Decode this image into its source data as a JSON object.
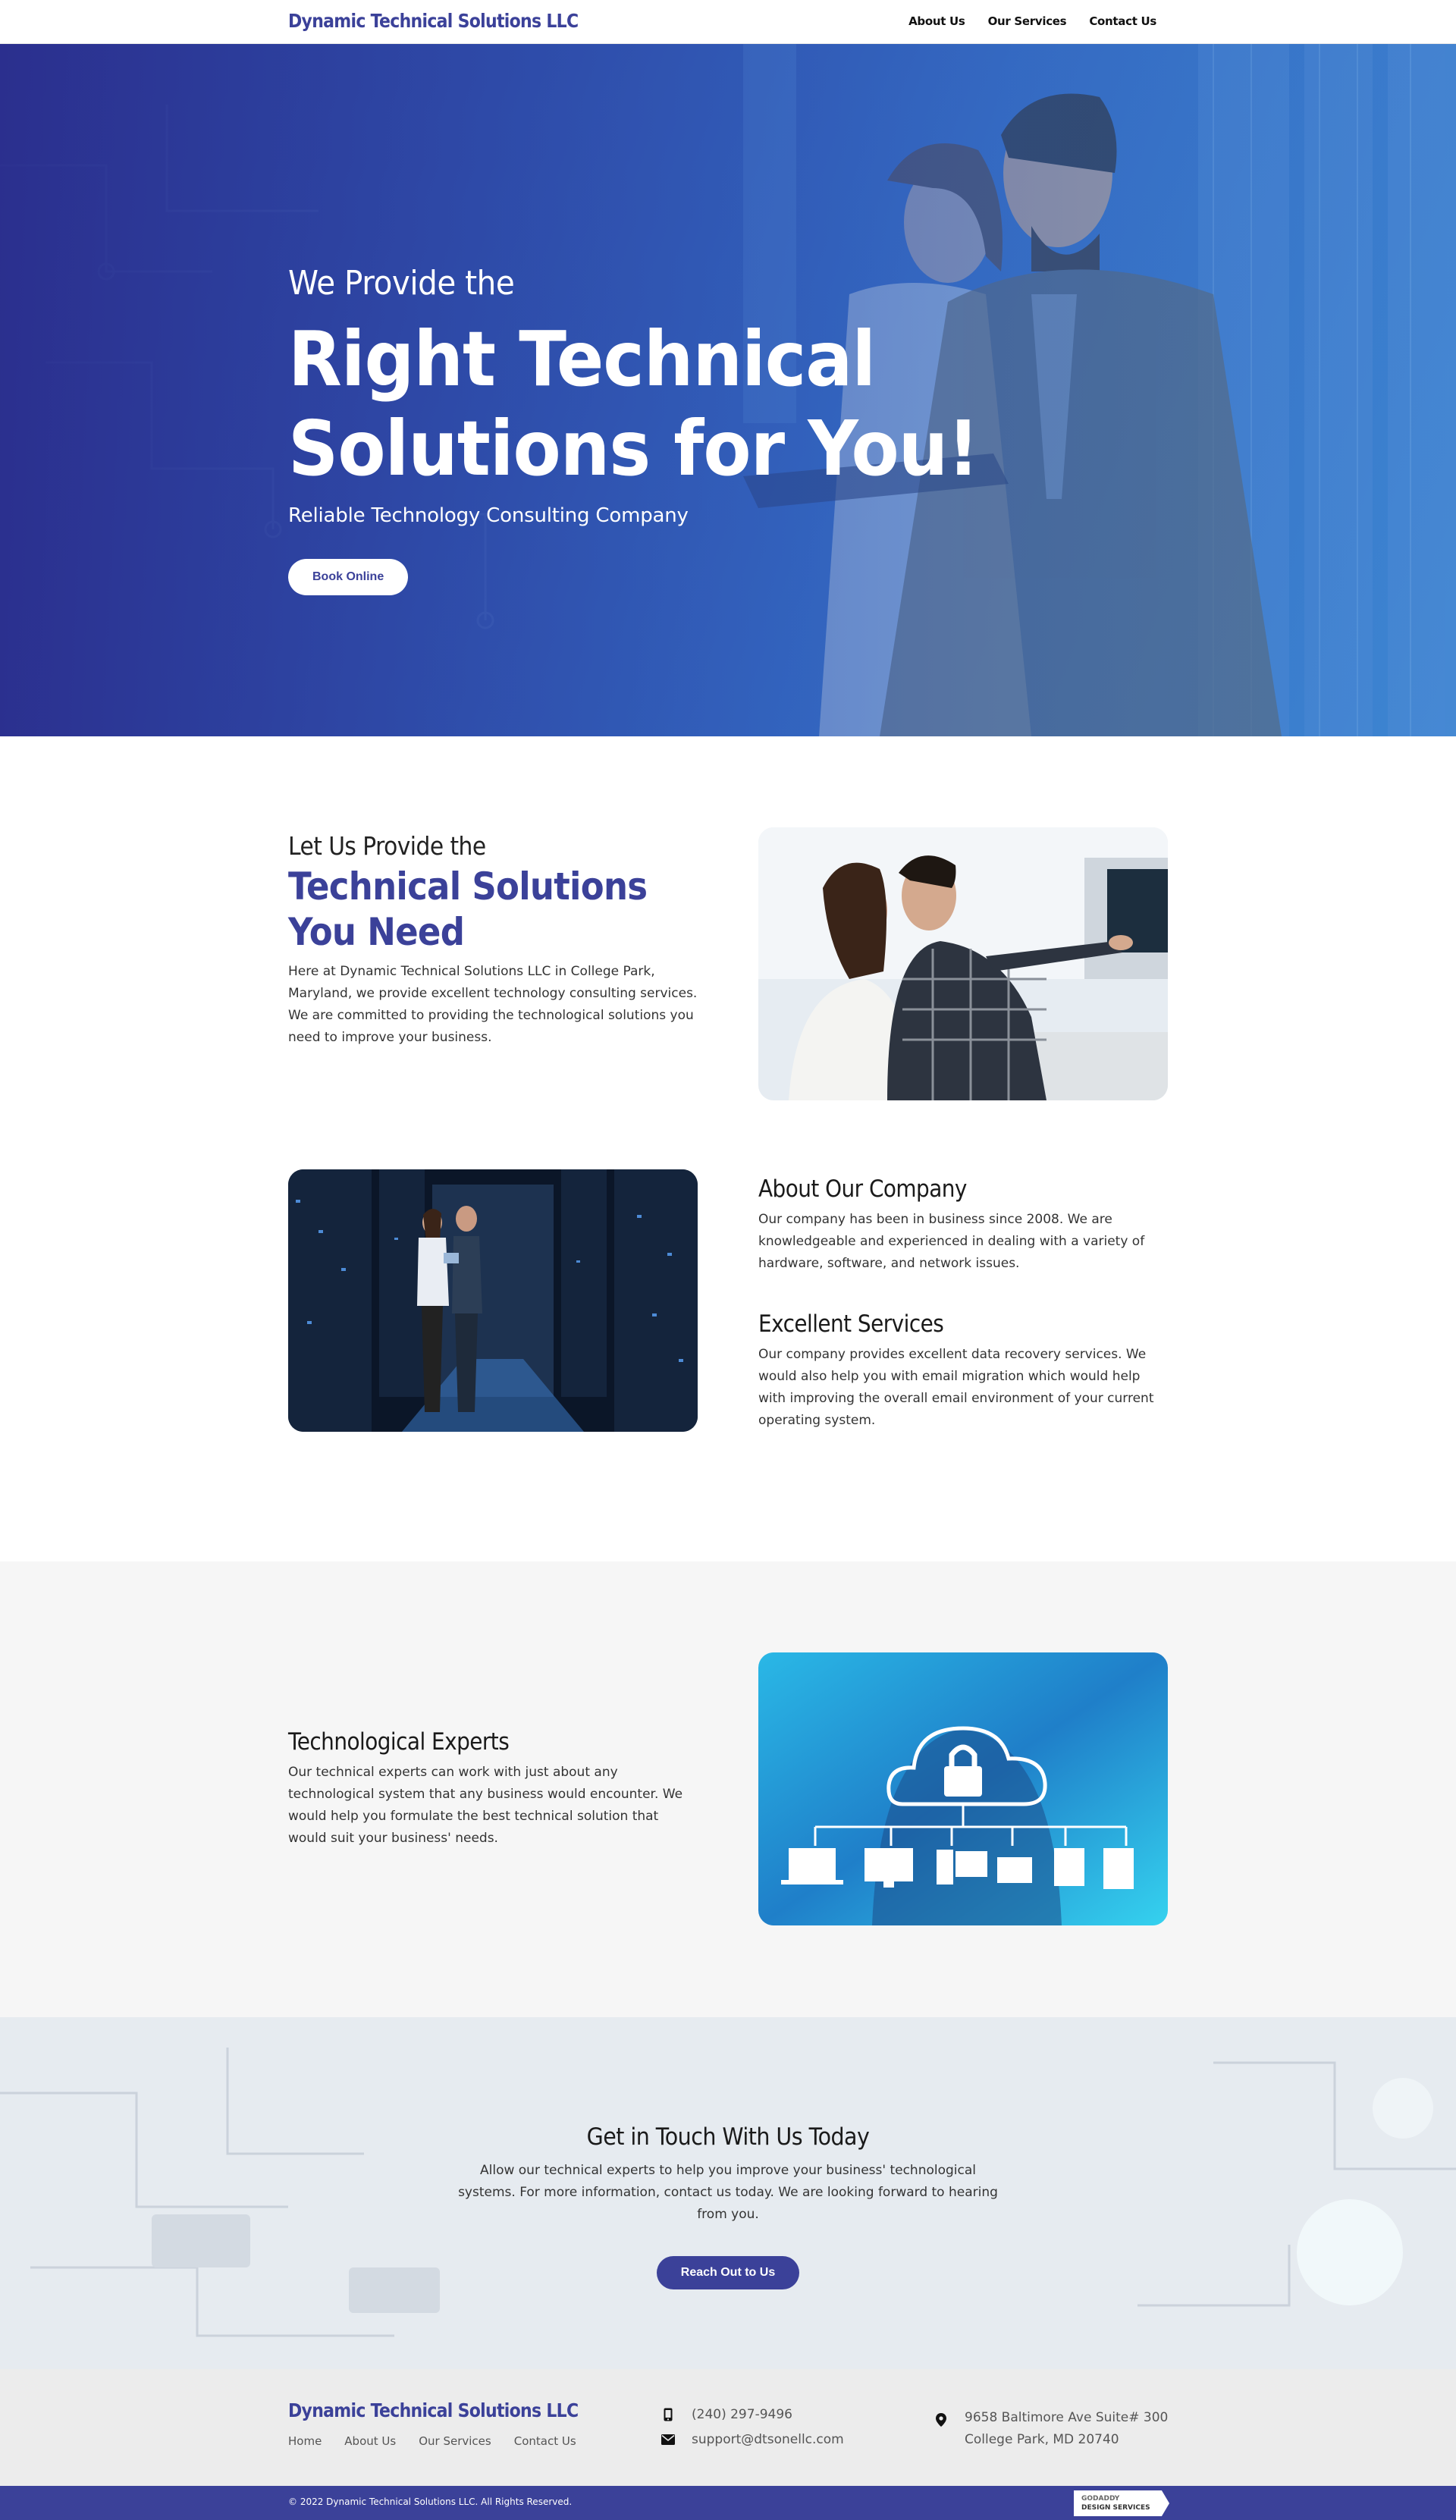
{
  "header": {
    "brand": "Dynamic Technical Solutions LLC",
    "nav": [
      "About Us",
      "Our Services",
      "Contact Us"
    ]
  },
  "hero": {
    "pre_title": "We Provide the",
    "title_line1": "Right Technical",
    "title_line2": "Solutions for You!",
    "subtitle": "Reliable Technology Consulting Company",
    "button": "Book Online"
  },
  "intro": {
    "pre_heading": "Let Us Provide the",
    "heading_line1": "Technical Solutions",
    "heading_line2": "You Need",
    "body": "Here at Dynamic Technical Solutions LLC in College Park, Maryland, we provide excellent technology consulting services. We are committed to providing the technological solutions you need to improve your business."
  },
  "about": {
    "company_title": "About Our Company",
    "company_body": "Our company has been in business since 2008. We are knowledgeable and experienced in dealing with a variety of hardware, software, and network issues.",
    "services_title": "Excellent Services",
    "services_body": "Our company provides excellent data recovery services. We would also help you with email migration which would help with improving the overall email environment of your current operating system."
  },
  "experts": {
    "title": "Technological Experts",
    "body": "Our technical experts can work with just about any technological system that any business would encounter. We would help you formulate the best technical solution that would suit your business' needs."
  },
  "cta": {
    "title": "Get in Touch With Us Today",
    "body": "Allow our technical experts to help you improve your business' technological systems. For more information, contact us today. We are looking forward to hearing from you.",
    "button": "Reach Out to Us"
  },
  "footer": {
    "brand": "Dynamic Technical Solutions LLC",
    "nav": [
      "Home",
      "About Us",
      "Our Services",
      "Contact Us"
    ],
    "phone": "(240) 297-9496",
    "email": "support@dtsonellc.com",
    "address_line1": "9658 Baltimore Ave Suite# 300",
    "address_line2": "College Park, MD 20740",
    "copyright": "© 2022 Dynamic Technical Solutions LLC. All Rights Reserved.",
    "badge_line1": "GODADDY",
    "badge_line2": "DESIGN SERVICES"
  },
  "colors": {
    "brand": "#3b4199",
    "hero_gradient_start": "#2a2e8c",
    "hero_gradient_end": "#3d86d2",
    "section_gray": "#f6f6f6",
    "footer_bg": "#ececec"
  },
  "icons": [
    "phone-icon",
    "envelope-icon",
    "map-pin-icon",
    "cloud-lock-icon"
  ]
}
